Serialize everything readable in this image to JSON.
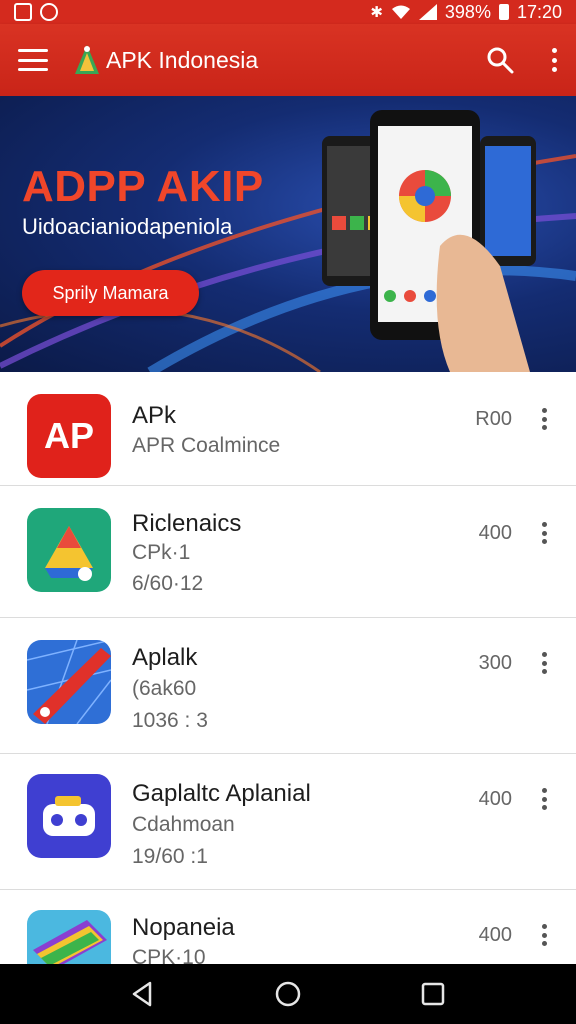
{
  "status_bar": {
    "left_icons": [
      "gallery-icon",
      "vine-icon"
    ],
    "right_icons": [
      "bluetooth-icon",
      "wifi-icon",
      "signal-icon"
    ],
    "battery_text": "398%",
    "time": "17:20"
  },
  "app_bar": {
    "title": "APK Indonesia",
    "icons": [
      "menu-icon",
      "logo-icon",
      "search-icon",
      "more-vert-icon"
    ]
  },
  "banner": {
    "title": "ADPP AKIP",
    "subtitle": "Uidoacianiodapeniola",
    "button_label": "Sprily Mamara"
  },
  "apps": [
    {
      "name": "APk",
      "subtitle": "APR Coalmince",
      "version": "",
      "size": "R00",
      "icon": "ap-logo-icon",
      "icon_color": "#e0221b"
    },
    {
      "name": "Riclenaics",
      "subtitle": "CPk·1",
      "version": "6/60·12",
      "size": "400",
      "icon": "drive-triangle-icon",
      "icon_color": "#1fa77a"
    },
    {
      "name": "Aplalk",
      "subtitle": "(6ak60",
      "version": "1036 : 3",
      "size": "300",
      "icon": "map-ribbon-icon",
      "icon_color": "#2f6fd6"
    },
    {
      "name": "Gaplaltc Aplanial",
      "subtitle": "Cdahmoan",
      "version": "19/60 :1",
      "size": "400",
      "icon": "game-pad-icon",
      "icon_color": "#3f3fd1"
    },
    {
      "name": "Nopaneia",
      "subtitle": "CPK·10",
      "version": "",
      "size": "400",
      "icon": "book-stack-icon",
      "icon_color": "#4bb8e0"
    }
  ],
  "nav_bar": {
    "buttons": [
      "back-icon",
      "home-icon",
      "recents-icon"
    ]
  },
  "colors": {
    "brand_red": "#d42a1e",
    "banner_blue": "#142c72",
    "nav_black": "#000000"
  }
}
